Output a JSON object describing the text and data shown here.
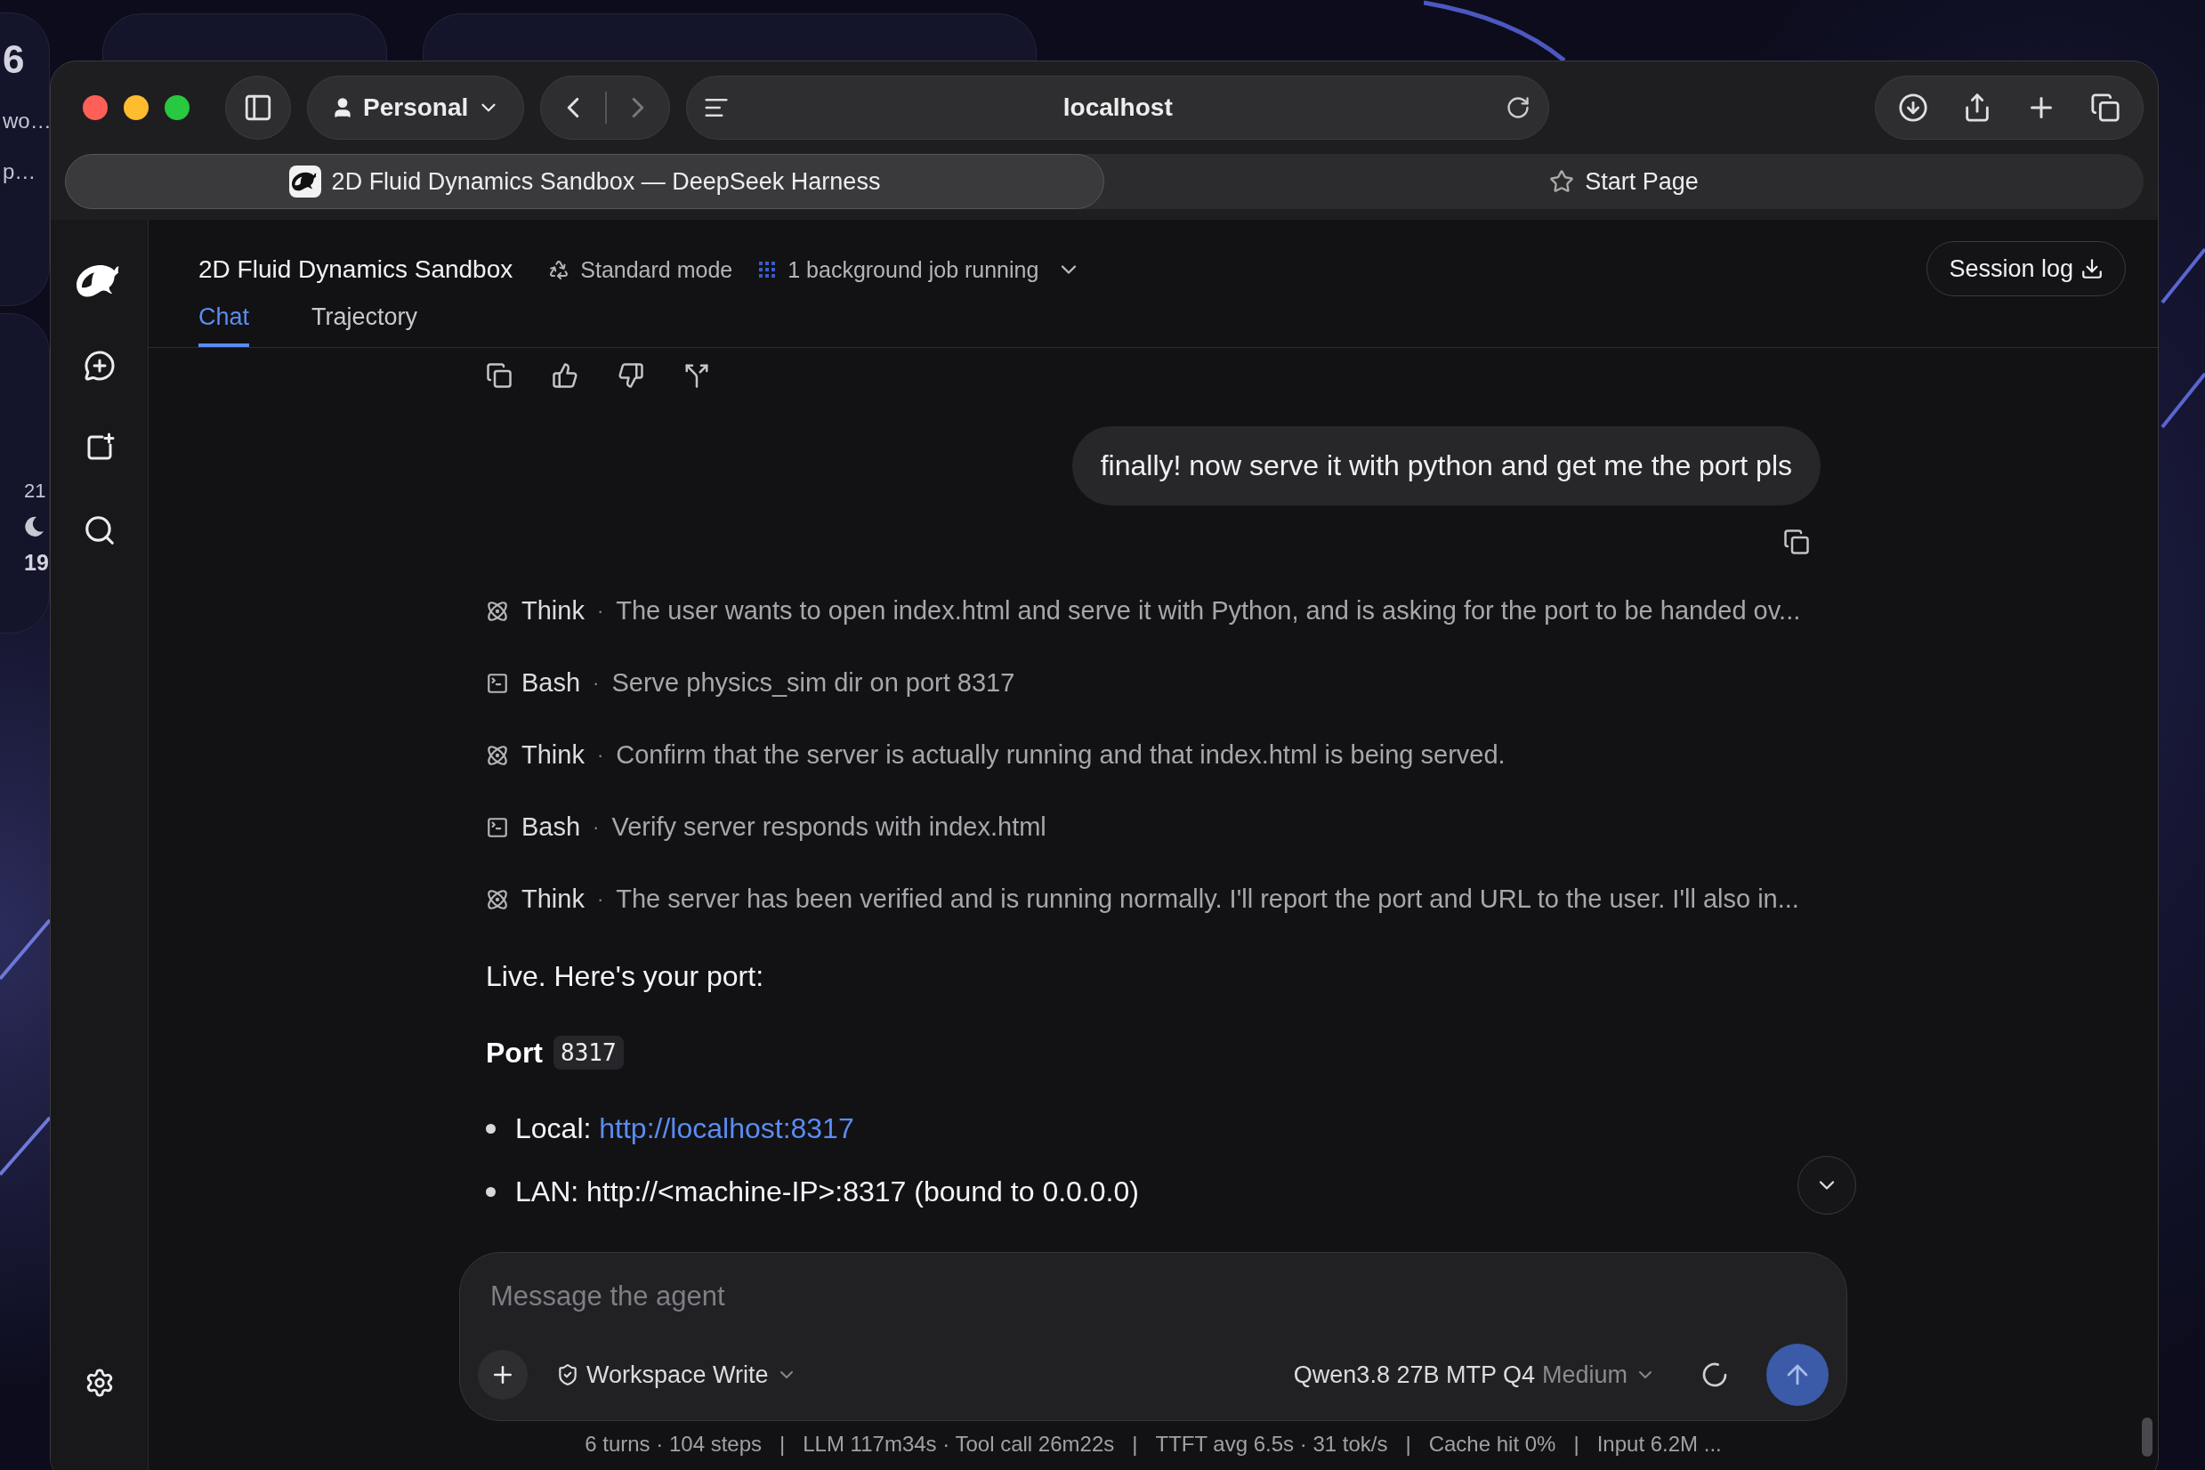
{
  "desktop": {
    "widgets": [
      {
        "kind": "date",
        "texts": [
          "6",
          "wo…",
          "p…"
        ]
      },
      {
        "kind": "blank"
      },
      {
        "kind": "blank"
      },
      {
        "kind": "weather",
        "texts": [
          "21",
          "19"
        ]
      }
    ]
  },
  "browser": {
    "profile": "Personal",
    "address": "localhost",
    "tabs": [
      {
        "title": "2D Fluid Dynamics Sandbox — DeepSeek Harness",
        "kind": "page",
        "selected": true
      },
      {
        "title": "Start Page",
        "kind": "start",
        "selected": false
      }
    ]
  },
  "app": {
    "title": "2D Fluid Dynamics Sandbox",
    "mode": "Standard mode",
    "jobs": "1 background job running",
    "session_log": "Session log",
    "tabs": [
      {
        "label": "Chat",
        "selected": true
      },
      {
        "label": "Trajectory",
        "selected": false
      }
    ]
  },
  "chat": {
    "user_message": "finally! now serve it with python and get me the port pls",
    "step_separator": "·",
    "steps": [
      {
        "kind": "think",
        "label": "Think",
        "text": "The user wants to open index.html and serve it with Python, and is asking for the port to be handed ov..."
      },
      {
        "kind": "bash",
        "label": "Bash",
        "text": "Serve physics_sim dir on port 8317"
      },
      {
        "kind": "think",
        "label": "Think",
        "text": "Confirm that the server is actually running and that index.html is being served."
      },
      {
        "kind": "bash",
        "label": "Bash",
        "text": "Verify server responds with index.html"
      },
      {
        "kind": "think",
        "label": "Think",
        "text": "The server has been verified and is running normally. I'll report the port and URL to the user. I'll also in..."
      }
    ],
    "reply": {
      "intro": "Live. Here's your port:",
      "port_label": "Port",
      "port_value": "8317",
      "bullets": [
        {
          "label": "Local:",
          "link": "http://localhost:8317"
        },
        {
          "label": "LAN: http://<machine-IP>:8317 (bound to 0.0.0.0)"
        }
      ]
    }
  },
  "composer": {
    "placeholder": "Message the agent",
    "permission": "Workspace Write",
    "model": "Qwen3.8 27B MTP Q4",
    "effort": "Medium"
  },
  "status_bar": {
    "separator": "|",
    "items": [
      "6 turns · 104 steps",
      "LLM 117m34s · Tool call 26m22s",
      "TTFT avg 6.5s · 31 tok/s",
      "Cache hit 0%",
      "Input 6.2M ..."
    ]
  }
}
